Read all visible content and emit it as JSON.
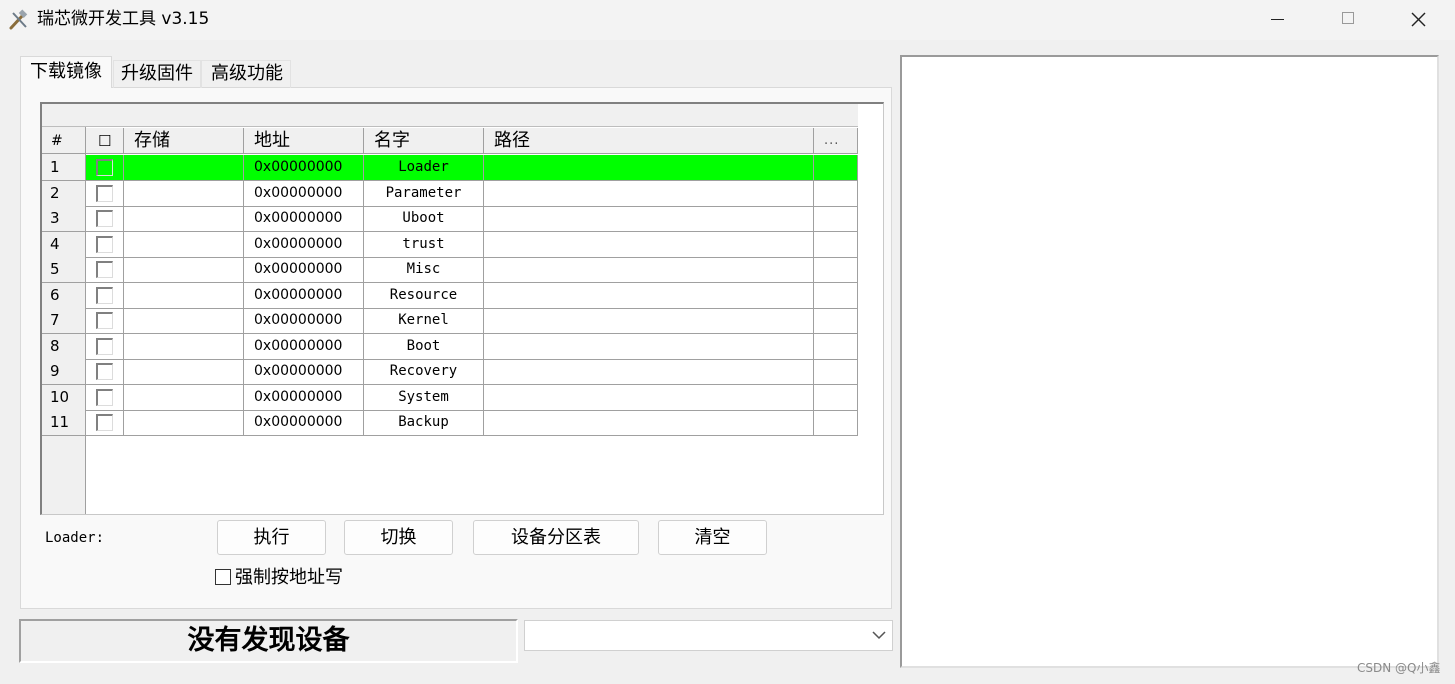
{
  "window": {
    "title": "瑞芯微开发工具 v3.15"
  },
  "tabs": [
    "下载镜像",
    "升级固件",
    "高级功能"
  ],
  "grid": {
    "headers": [
      "#",
      "☐",
      "存储",
      "地址",
      "名字",
      "路径",
      "..."
    ],
    "rows": [
      {
        "num": "1",
        "address": "0x00000000",
        "name": "Loader",
        "highlighted": true
      },
      {
        "num": "2",
        "address": "0x00000000",
        "name": "Parameter"
      },
      {
        "num": "3",
        "address": "0x00000000",
        "name": "Uboot"
      },
      {
        "num": "4",
        "address": "0x00000000",
        "name": "trust"
      },
      {
        "num": "5",
        "address": "0x00000000",
        "name": "Misc"
      },
      {
        "num": "6",
        "address": "0x00000000",
        "name": "Resource"
      },
      {
        "num": "7",
        "address": "0x00000000",
        "name": "Kernel"
      },
      {
        "num": "8",
        "address": "0x00000000",
        "name": "Boot"
      },
      {
        "num": "9",
        "address": "0x00000000",
        "name": "Recovery"
      },
      {
        "num": "10",
        "address": "0x00000000",
        "name": "System"
      },
      {
        "num": "11",
        "address": "0x00000000",
        "name": "Backup"
      }
    ],
    "highlight_color": "#00ff00"
  },
  "controls": {
    "loader_label": "Loader:",
    "execute": "执行",
    "switch": "切换",
    "partition_table": "设备分区表",
    "clear": "清空",
    "force_write_label": "强制按地址写"
  },
  "status": {
    "text": "没有发现设备"
  },
  "watermark": "CSDN @Q小鑫"
}
